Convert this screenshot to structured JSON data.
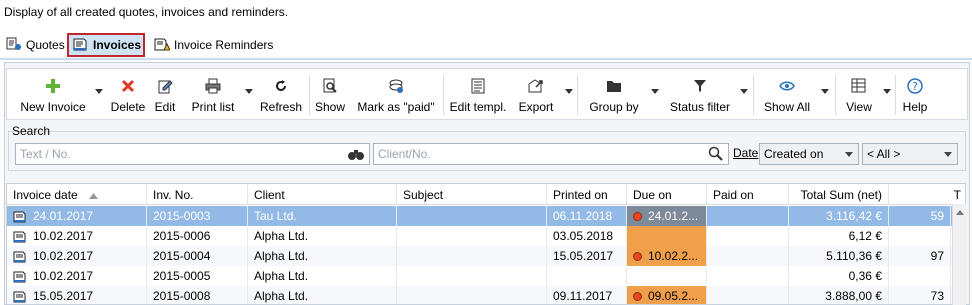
{
  "description": "Display of all created quotes, invoices and reminders.",
  "tabs": [
    {
      "label": "Quotes"
    },
    {
      "label": "Invoices"
    },
    {
      "label": "Invoice Reminders"
    }
  ],
  "toolbar": {
    "new_invoice": "New Invoice",
    "delete": "Delete",
    "edit": "Edit",
    "print_list": "Print list",
    "refresh": "Refresh",
    "show": "Show",
    "mark_paid": "Mark as \"paid\"",
    "edit_templ": "Edit templ.",
    "export": "Export",
    "group_by": "Group by",
    "status_filter": "Status filter",
    "show_all": "Show All",
    "view": "View",
    "help": "Help"
  },
  "search": {
    "label": "Search",
    "text_placeholder": "Text / No.",
    "client_placeholder": "Client/No.",
    "date_label": "Date",
    "date_field": "Created on",
    "date_range": "< All >"
  },
  "table": {
    "headers": [
      "Invoice date",
      "Inv. No.",
      "Client",
      "Subject",
      "Printed on",
      "Due on",
      "Paid on",
      "Total Sum (net)",
      "T"
    ],
    "rows": [
      {
        "date": "24.01.2017",
        "no": "2015-0003",
        "client": "Tau Ltd.",
        "subject": "",
        "printed": "06.11.2018",
        "due": "24.01.2...",
        "paid": "",
        "total": "3.116,42 €",
        "extra": "59"
      },
      {
        "date": "10.02.2017",
        "no": "2015-0006",
        "client": "Alpha Ltd.",
        "subject": "",
        "printed": "03.05.2018",
        "due": "",
        "paid": "",
        "total": "6,12 €",
        "extra": ""
      },
      {
        "date": "10.02.2017",
        "no": "2015-0004",
        "client": "Alpha Ltd.",
        "subject": "",
        "printed": "15.05.2017",
        "due": "10.02.2...",
        "paid": "",
        "total": "5.110,36 €",
        "extra": "97"
      },
      {
        "date": "10.02.2017",
        "no": "2015-0005",
        "client": "Alpha Ltd.",
        "subject": "",
        "printed": "",
        "due": "",
        "paid": "",
        "total": "0,36 €",
        "extra": ""
      },
      {
        "date": "15.05.2017",
        "no": "2015-0008",
        "client": "Alpha Ltd.",
        "subject": "",
        "printed": "09.11.2017",
        "due": "09.05.2...",
        "paid": "",
        "total": "3.888,00 €",
        "extra": "73"
      }
    ]
  },
  "colors": {
    "highlight": "#c0272d",
    "selected_row": "#93b9e6",
    "overdue": "#f0a04b"
  }
}
